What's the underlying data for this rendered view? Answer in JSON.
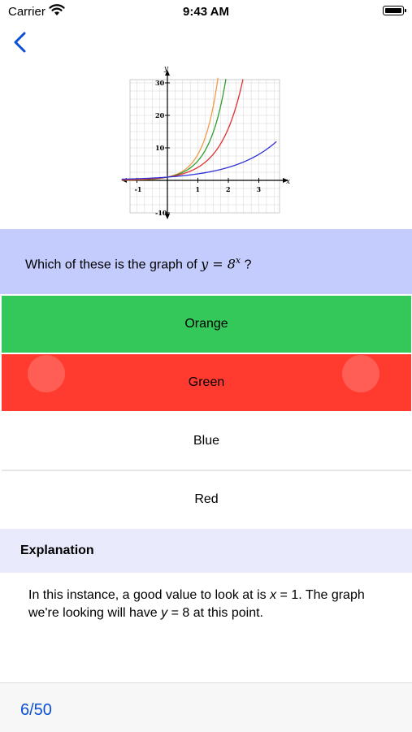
{
  "status_bar": {
    "carrier": "Carrier",
    "time": "9:43 AM"
  },
  "nav": {
    "back_icon": "chevron-left-icon"
  },
  "graph": {
    "type": "line",
    "axis_x_label": "x",
    "axis_y_label": "y",
    "x_ticks": [
      "-1",
      "1",
      "2",
      "3"
    ],
    "y_ticks": [
      "30",
      "20",
      "10",
      "-10"
    ],
    "series_colors": [
      "#f39a4a",
      "#2ea02e",
      "#e03030",
      "#3030d8"
    ]
  },
  "question": {
    "prefix": "Which of these is the graph of ",
    "math": "y = 8",
    "exponent": "x",
    "suffix": " ?"
  },
  "options": [
    {
      "label": "Orange",
      "state": "correct",
      "color": "#34c85a"
    },
    {
      "label": "Green",
      "state": "incorrect",
      "color": "#ff3b30"
    },
    {
      "label": "Blue",
      "state": "neutral",
      "color": "#ffffff"
    },
    {
      "label": "Red",
      "state": "neutral",
      "color": "#ffffff"
    }
  ],
  "explanation": {
    "title": "Explanation",
    "part1": "In this instance, a good value to look at is ",
    "var_x": "x",
    "part2": " = 1. The graph we're looking will have ",
    "var_y": "y",
    "part3": " = 8 at this point."
  },
  "footer": {
    "progress": "6/50"
  },
  "colors": {
    "accent": "#0a4fd6",
    "question_bg": "#c3ccfd",
    "explanation_bg": "#e9ebfd"
  }
}
